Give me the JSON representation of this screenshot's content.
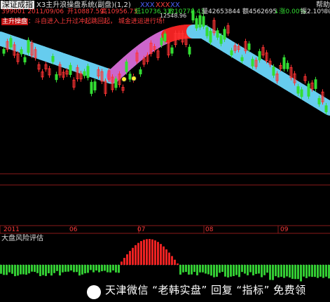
{
  "header": {
    "index_name": "深证成指",
    "indicator_title": "X3主升浪操盘系统(副盘)(1,2)",
    "legend_tags": [
      "XXX",
      "XXX",
      "XX"
    ],
    "help_text": "帮助"
  },
  "info_line": {
    "code_date": "399001 2011/09/06",
    "open": "开10887.59",
    "high": "高10956.73",
    "low": "低10736.33",
    "close": "收10778.43",
    "volume": "量42653844",
    "amount": "额4562695",
    "change": "↓涨0.00%",
    "amplitude": "振2.10%",
    "end": "%"
  },
  "tagline": {
    "badge": "主升操盘",
    "text": "：斗自进入上升过冲起跳回起， 城金进运进行场!"
  },
  "annotations": {
    "peak_value": "12548.96"
  },
  "time_axis": {
    "labels": [
      "2011",
      "06",
      "07",
      "08",
      "09"
    ]
  },
  "subpanel": {
    "title": "大盘风险评估"
  },
  "watermark": {
    "text": "天津微信 “老韩实盘” 回复 “指标” 免费领"
  },
  "colors": {
    "background": "#000000",
    "up_candle": "#33dd33",
    "down_candle": "#ff3333",
    "band_down": "#66ccee",
    "band_up": "#cc66cc",
    "band_peak": "#ee2222",
    "hist_positive": "#ee2222",
    "hist_negative": "#33cc33",
    "guide_lines": "#8a1a1a"
  }
}
